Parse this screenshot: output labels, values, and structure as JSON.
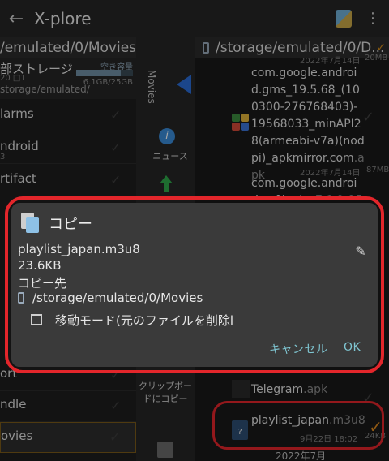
{
  "app": {
    "title": "X-plore"
  },
  "left_pane": {
    "path": "/emulated/0/Movies",
    "storage": {
      "name": "部ストレージ",
      "meta": "20 □1",
      "path": "storage/emulated/",
      "free_label": "空き容量",
      "free_value": "6.1GB/25GB",
      "free_fraction": 0.78
    },
    "rows": [
      {
        "label": "larms",
        "sub": ""
      },
      {
        "label": "ndroid",
        "sub": "3"
      },
      {
        "label": "rtifact",
        "sub": ""
      },
      {
        "label": "ort",
        "sub": ""
      },
      {
        "label": "ndle",
        "sub": ""
      },
      {
        "label": "ovies",
        "sub": ""
      }
    ]
  },
  "middle_toolbar": {
    "vertical_label": "Movies",
    "news_label": "ニュース",
    "clipboard_label": "クリップボードにコピー"
  },
  "right_pane": {
    "path": "/storage/emulated/0/D...",
    "items": [
      {
        "meta": "2022年7月14日",
        "size": "20MB"
      },
      {
        "name": "com.google.android.gms_19.5.68_(100300-276768403)-19568033_minAPI28(armeabi-v7a)(nodpi)_apkmirror.com",
        "ext": ".apk",
        "meta": "2022年7月14日",
        "size": "87MB"
      },
      {
        "name": "com.google.android.gsf.login_7.1.2-25_m",
        "ext": ""
      },
      {
        "name": "Telegram",
        "ext": ".apk"
      },
      {
        "name": "playlist_japan",
        "ext": ".m3u8",
        "meta": "9月22日 18:02",
        "size": "24KB"
      },
      {
        "name": "2022年7月",
        "ext": ""
      }
    ]
  },
  "dialog": {
    "title": "コピー",
    "filename": "playlist_japan.m3u8",
    "filesize": "23.6KB",
    "dest_label": "コピー先",
    "dest_path": "/storage/emulated/0/Movies",
    "move_mode_label": "移動モード(元のファイルを削除l",
    "move_mode_checked": false,
    "cancel_label": "キャンセル",
    "ok_label": "OK"
  },
  "colors": {
    "highlight_ring": "#e3262b",
    "accent_button": "#7fc6d2",
    "dialog_bg": "#3a3a3a",
    "selected_check": "#e08a1e"
  }
}
